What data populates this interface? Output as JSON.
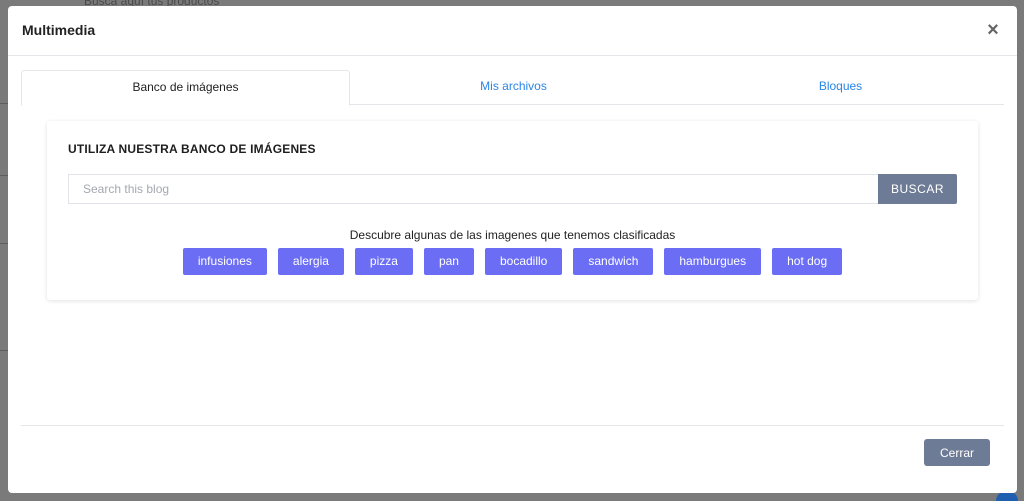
{
  "background": {
    "search_hint": "Busca aquí tus productos"
  },
  "modal": {
    "title": "Multimedia",
    "close_symbol": "×",
    "tabs": [
      {
        "label": "Banco de imágenes",
        "active": true
      },
      {
        "label": "Mis archivos",
        "active": false
      },
      {
        "label": "Bloques",
        "active": false
      }
    ],
    "card": {
      "title": "UTILIZA NUESTRA BANCO DE IMÁGENES",
      "search": {
        "placeholder": "Search this blog",
        "value": "",
        "button_label": "BUSCAR"
      },
      "discover_text": "Descubre algunas de las imagenes que tenemos clasificadas",
      "tags": [
        "infusiones",
        "alergia",
        "pizza",
        "pan",
        "bocadillo",
        "sandwich",
        "hamburgues",
        "hot dog"
      ]
    },
    "footer": {
      "close_label": "Cerrar"
    }
  },
  "colors": {
    "tab_link": "#2a86e6",
    "tag_bg": "#6b6ef5",
    "button_bg": "#6e7b96",
    "overlay": "#7a7a7a"
  }
}
